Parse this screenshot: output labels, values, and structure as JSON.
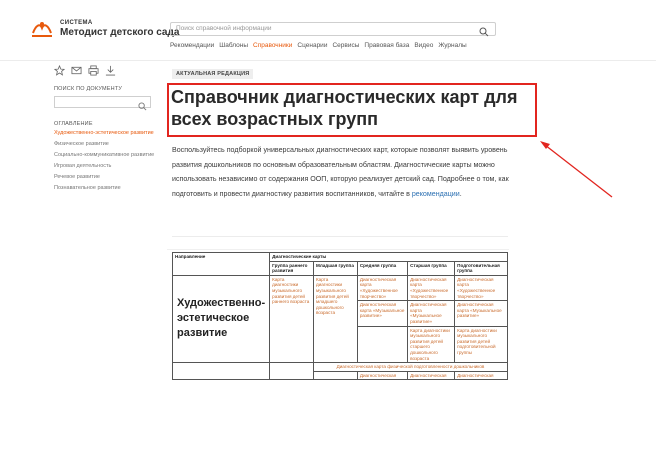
{
  "logo": {
    "small": "СИСТЕМА",
    "big": "Методист детского сада",
    "icon": "hands-logo-icon",
    "color": "#e8590c"
  },
  "search": {
    "placeholder": "Поиск справочной информации",
    "icon": "search-icon"
  },
  "nav": [
    {
      "label": "Рекомендации",
      "active": false
    },
    {
      "label": "Шаблоны",
      "active": false
    },
    {
      "label": "Справочники",
      "active": true
    },
    {
      "label": "Сценарии",
      "active": false
    },
    {
      "label": "Сервисы",
      "active": false
    },
    {
      "label": "Правовая база",
      "active": false
    },
    {
      "label": "Видео",
      "active": false
    },
    {
      "label": "Журналы",
      "active": false
    }
  ],
  "tools": [
    "star-icon",
    "mail-icon",
    "print-icon",
    "download-icon"
  ],
  "sidebar": {
    "search_label": "ПОИСК ПО ДОКУМЕНТУ",
    "toc_label": "ОГЛАВЛЕНИЕ",
    "toc": [
      {
        "label": "Художественно-эстетическое развитие",
        "active": true
      },
      {
        "label": "Физическое развитие",
        "active": false
      },
      {
        "label": "Социально-коммуникативное развитие",
        "active": false
      },
      {
        "label": "Игровая деятельность",
        "active": false
      },
      {
        "label": "Речевое развитие",
        "active": false
      },
      {
        "label": "Познавательное развитие",
        "active": false
      }
    ]
  },
  "main": {
    "badge": "АКТУАЛЬНАЯ РЕДАКЦИЯ",
    "title": "Справочник диагностических карт для всех возрастных групп",
    "desc_text": "Воспользуйтесь подборкой универсальных диагностических карт, которые позволят выявить уровень развития дошкольников по основным образовательным областям. Диагностические карты можно использовать независимо от содержания ООП, которую реализует детский сад. Подробнее о том, как подготовить и провести диагностику развития воспитанников, читайте в ",
    "desc_link": "рекомендации",
    "desc_end": "."
  },
  "highlight_color": "#e2251f",
  "table": {
    "h_direction": "Направление",
    "h_cards": "Диагностические карты",
    "cols": [
      "Группа раннего развития",
      "Младшая группа",
      "Средняя группа",
      "Старшая группа",
      "Подготовительная группа"
    ],
    "section": "Художественно-эстетическое развитие",
    "early": "Карта диагностики музыкального развития детей раннего возраста",
    "junior": "Карта диагностики музыкального развития детей младшего дошкольного возраста",
    "r1": [
      "Диагностическая карта «Художественное творчество»",
      "Диагностическая карта «Художественное творчество»",
      "Диагностическая карта «Художественное творчество»"
    ],
    "r2": [
      "Диагностическая карта «Музыкальное развитие»",
      "Диагностическая карта «Музыкальное развитие»",
      "Диагностическая карта «Музыкальное развитие»"
    ],
    "r3_senior": "Карта диагностики музыкального развития детей старшего дошкольного возраста",
    "r3_prep": "Карта диагностики музыкального развития детей подготовительной группы",
    "phys_row": "Диагностическая карта физической подготовленности дошкольников",
    "last": [
      "Диагностическая",
      "Диагностическая",
      "Диагностическая"
    ]
  }
}
